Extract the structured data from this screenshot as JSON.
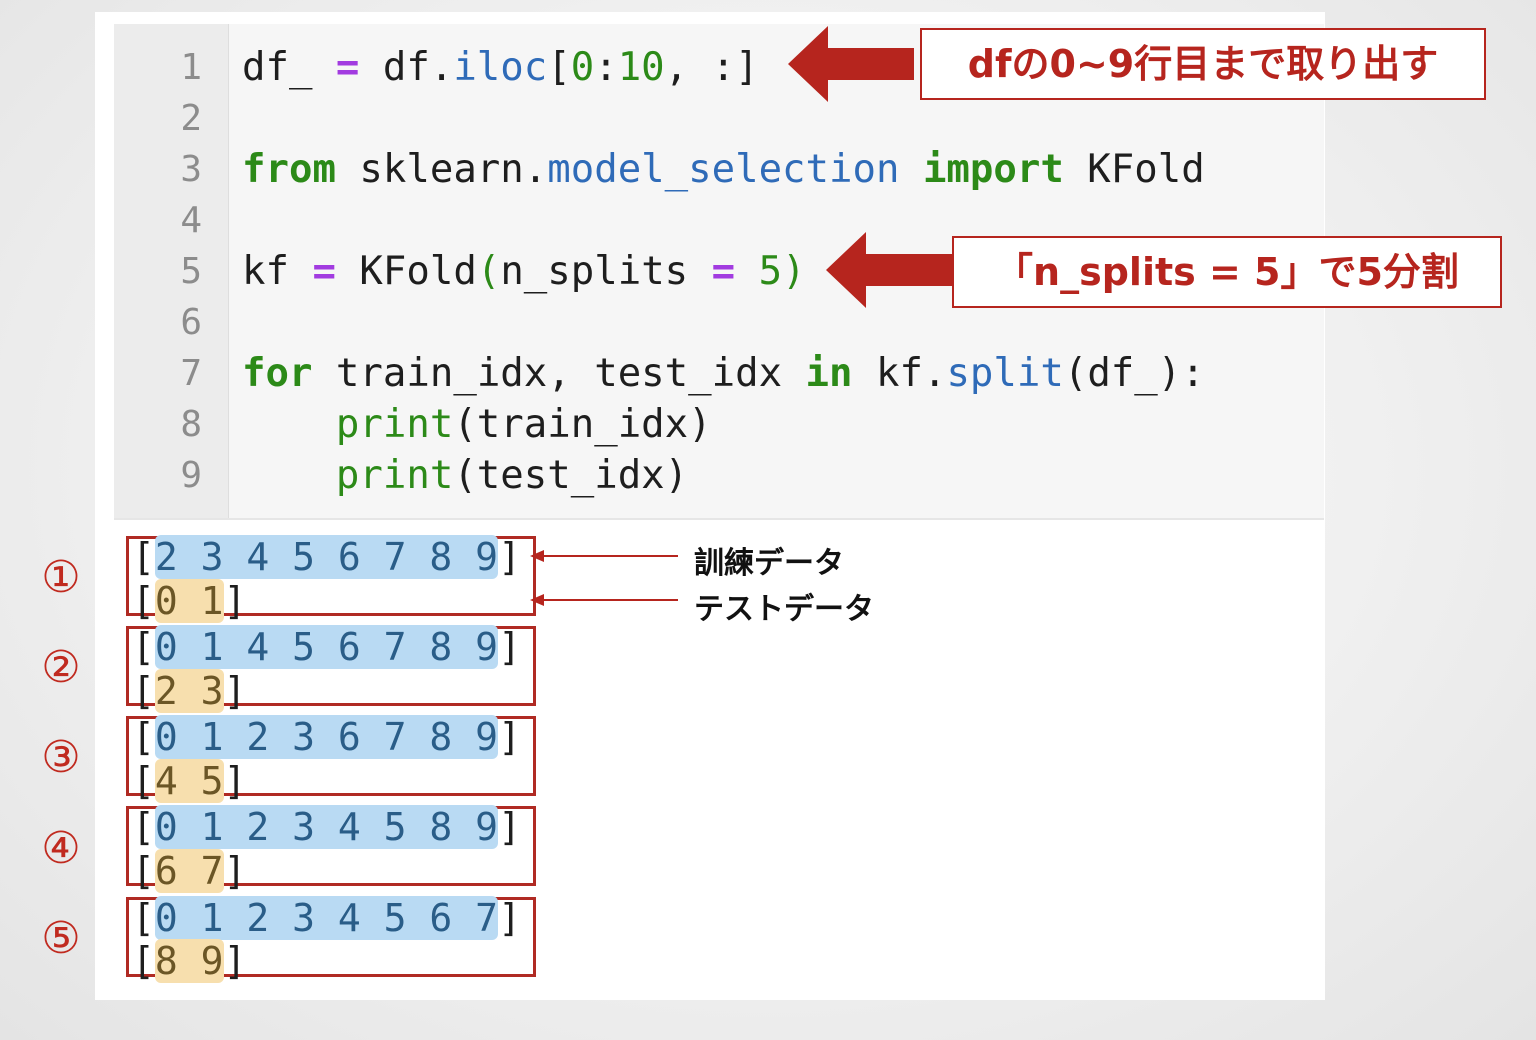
{
  "code": {
    "line_numbers": [
      "1",
      "2",
      "3",
      "4",
      "5",
      "6",
      "7",
      "8",
      "9"
    ],
    "l1": {
      "a": "df_ ",
      "b": "=",
      "c": " df.",
      "d": "iloc",
      "e": "[",
      "f": "0",
      "g": ":",
      "h": "10",
      "i": ", :]"
    },
    "l3": {
      "a": "from",
      "b": " sklearn.",
      "c": "model_selection",
      "d": " ",
      "e": "import",
      "f": " KFold"
    },
    "l5": {
      "a": "kf ",
      "b": "=",
      "c": " KFold",
      "d": "(",
      "e": "n_splits ",
      "f": "=",
      "g": " ",
      "h": "5",
      "i": ")"
    },
    "l7": {
      "a": "for",
      "b": " train_idx, test_idx ",
      "c": "in",
      "d": " kf.",
      "e": "split",
      "f": "(df_):"
    },
    "l8": {
      "a": "    ",
      "b": "print",
      "c": "(train_idx)"
    },
    "l9": {
      "a": "    ",
      "b": "print",
      "c": "(test_idx)"
    }
  },
  "annotations": {
    "top": "dfの0~9行目まで取り出す",
    "mid": "「n_splits = 5」で5分割"
  },
  "legend": {
    "train": "訓練データ",
    "test": "テストデータ"
  },
  "folds": [
    {
      "num": "①",
      "train": "2 3 4 5 6 7 8 9",
      "test": "0 1"
    },
    {
      "num": "②",
      "train": "0 1 4 5 6 7 8 9",
      "test": "2 3"
    },
    {
      "num": "③",
      "train": "0 1 2 3 6 7 8 9",
      "test": "4 5"
    },
    {
      "num": "④",
      "train": "0 1 2 3 4 5 8 9",
      "test": "6 7"
    },
    {
      "num": "⑤",
      "train": "0 1 2 3 4 5 6 7",
      "test": "8 9"
    }
  ],
  "colors": {
    "accent_red": "#b6251e",
    "train_highlight": "#b9daf3",
    "test_highlight": "#f7dfae",
    "keyword_green": "#2c8a18",
    "operator_purple": "#a23be0"
  }
}
